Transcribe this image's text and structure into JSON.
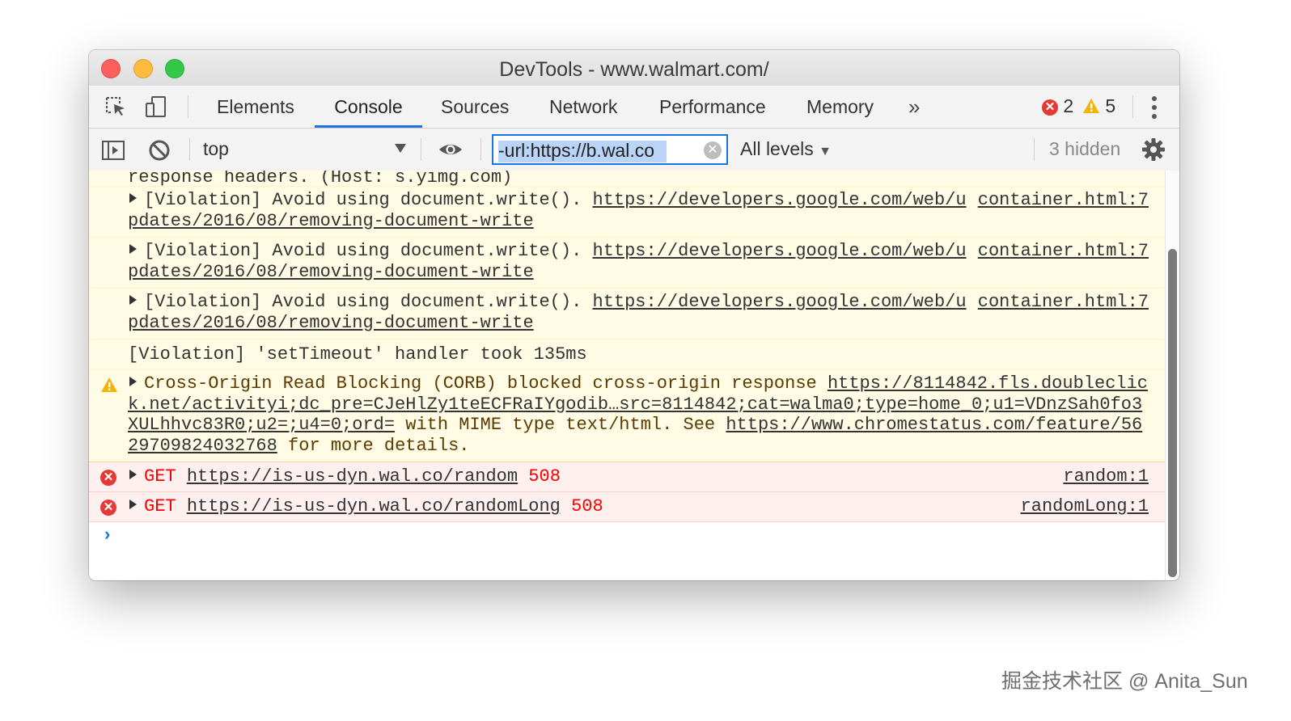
{
  "window": {
    "title": "DevTools - www.walmart.com/"
  },
  "tabs": [
    {
      "label": "Elements",
      "active": false
    },
    {
      "label": "Console",
      "active": true
    },
    {
      "label": "Sources",
      "active": false
    },
    {
      "label": "Network",
      "active": false
    },
    {
      "label": "Performance",
      "active": false
    },
    {
      "label": "Memory",
      "active": false
    }
  ],
  "more_tabs_label": "»",
  "counts": {
    "errors": "2",
    "warnings": "5"
  },
  "toolbar": {
    "context": "top",
    "filter_value": "-url:https://b.wal.co",
    "levels": "All levels",
    "hidden": "3 hidden"
  },
  "messages": {
    "partial_top": "response headers. (Host: s.yimg.com)",
    "violations": [
      {
        "text": "[Violation] Avoid using document.write().",
        "link1": "https://developers.google.com/web/u",
        "link2": "pdates/2016/08/removing-document-write",
        "source": "container.html:7"
      },
      {
        "text": "[Violation] Avoid using document.write().",
        "link1": "https://developers.google.com/web/u",
        "link2": "pdates/2016/08/removing-document-write",
        "source": "container.html:7"
      },
      {
        "text": "[Violation] Avoid using document.write().",
        "link1": "https://developers.google.com/web/u",
        "link2": "pdates/2016/08/removing-document-write",
        "source": "container.html:7"
      }
    ],
    "timeout": "[Violation] 'setTimeout' handler took 135ms",
    "corb": {
      "prefix": "Cross-Origin Read Blocking (CORB) blocked cross-origin response ",
      "url": "https://8114842.fls.doubleclick.net/activityi;dc_pre=CJeHlZy1teECFRaIYgodib…src=8114842;cat=walma0;type=home_0;u1=VDnzSah0fo3XULhhvc83R0;u2=;u4=0;ord=",
      "middle": " with MIME type text/html. See ",
      "link": "https://www.chromestatus.com/feature/5629709824032768",
      "suffix": " for more details."
    },
    "errors": [
      {
        "method": "GET",
        "url": "https://is-us-dyn.wal.co/random",
        "status": "508",
        "source": "random:1"
      },
      {
        "method": "GET",
        "url": "https://is-us-dyn.wal.co/randomLong",
        "status": "508",
        "source": "randomLong:1"
      }
    ],
    "prompt": "›"
  },
  "watermark": "掘金技术社区 @ Anita_Sun",
  "colors": {
    "accent": "#1a73e8",
    "error": "#e53935",
    "warning_bg": "#fffbe5",
    "error_bg": "#fff0f0"
  }
}
